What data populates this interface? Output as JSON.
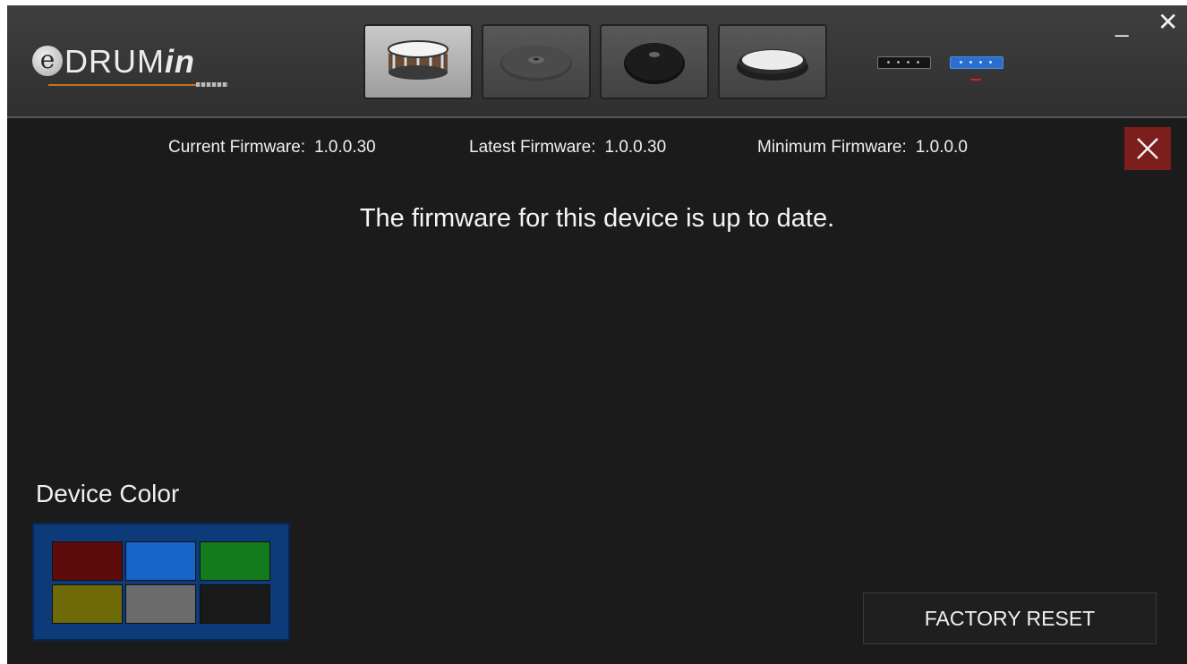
{
  "app": {
    "logo": {
      "prefix": "e",
      "main": "DRUM",
      "suffix": "in"
    }
  },
  "toolbar": {
    "tabs": [
      {
        "name": "snare-drum",
        "active": true
      },
      {
        "name": "cymbal-gray",
        "active": false
      },
      {
        "name": "cymbal-black",
        "active": false
      },
      {
        "name": "pad-white",
        "active": false
      }
    ],
    "ports": [
      {
        "name": "port-1",
        "active": false
      },
      {
        "name": "port-2",
        "active": true
      }
    ],
    "window_controls": {
      "minimize": "_",
      "close": "✕"
    }
  },
  "firmware": {
    "current_label": "Current Firmware:",
    "current_value": "1.0.0.30",
    "latest_label": "Latest Firmware:",
    "latest_value": "1.0.0.30",
    "minimum_label": "Minimum Firmware:",
    "minimum_value": "1.0.0.0"
  },
  "status_message": "The firmware for this device is up to date.",
  "device_color": {
    "label": "Device Color",
    "swatches": [
      {
        "name": "red",
        "color": "#5e0b0b"
      },
      {
        "name": "blue",
        "color": "#1865c9"
      },
      {
        "name": "green",
        "color": "#137b1b"
      },
      {
        "name": "yellow",
        "color": "#6e6a08"
      },
      {
        "name": "gray",
        "color": "#6b6b6b"
      },
      {
        "name": "black",
        "color": "#191919"
      }
    ]
  },
  "actions": {
    "factory_reset": "FACTORY RESET"
  },
  "colors": {
    "background": "#1b1b1b",
    "topbar": "#3a3a3a",
    "close_accent": "#7d1e1e",
    "logo_line": "#c5731e",
    "port_active": "#2a6fcf"
  }
}
